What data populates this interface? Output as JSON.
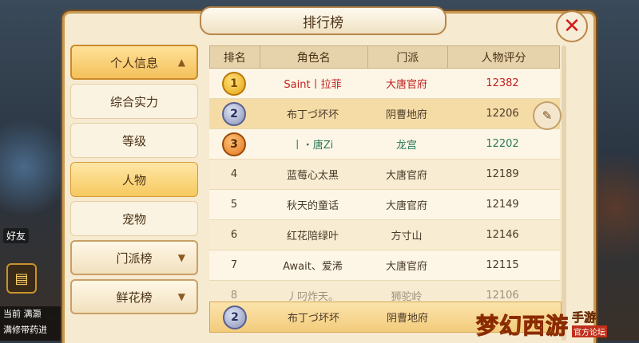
{
  "panel": {
    "title": "排行榜",
    "close_icon": "✕"
  },
  "hud": {
    "chip1": "好友",
    "chip2": "当前",
    "chip3": "满灏",
    "chat_line": "满修带药进"
  },
  "nav": {
    "personal_info": "个人信息",
    "sub_items": [
      "综合实力",
      "等级",
      "人物",
      "宠物"
    ],
    "sect_rank": "门派榜",
    "flower_rank": "鲜花榜"
  },
  "table": {
    "headers": [
      "排名",
      "角色名",
      "门派",
      "人物评分"
    ],
    "rows": [
      {
        "rank": "1",
        "name": "Saint丨拉菲",
        "sect": "大唐官府",
        "score": "12382"
      },
      {
        "rank": "2",
        "name": "布丁づ坏坏",
        "sect": "阴曹地府",
        "score": "12206"
      },
      {
        "rank": "3",
        "name": "丨・唐Zi",
        "sect": "龙宫",
        "score": "12202"
      },
      {
        "rank": "4",
        "name": "蓝莓心太黑",
        "sect": "大唐官府",
        "score": "12189"
      },
      {
        "rank": "5",
        "name": "秋天的童话",
        "sect": "大唐官府",
        "score": "12149"
      },
      {
        "rank": "6",
        "name": "红花陪绿叶",
        "sect": "方寸山",
        "score": "12146"
      },
      {
        "rank": "7",
        "name": "Await、爱浠",
        "sect": "大唐官府",
        "score": "12115"
      },
      {
        "rank": "8",
        "name": "丿叼炸天。",
        "sect": "狮驼岭",
        "score": "12106"
      }
    ],
    "mine": {
      "rank": "2",
      "name": "布丁づ坏坏",
      "sect": "阴曹地府"
    }
  },
  "watermark": {
    "main": "梦幻西游",
    "sub": "手游",
    "tag": "官方论坛"
  }
}
